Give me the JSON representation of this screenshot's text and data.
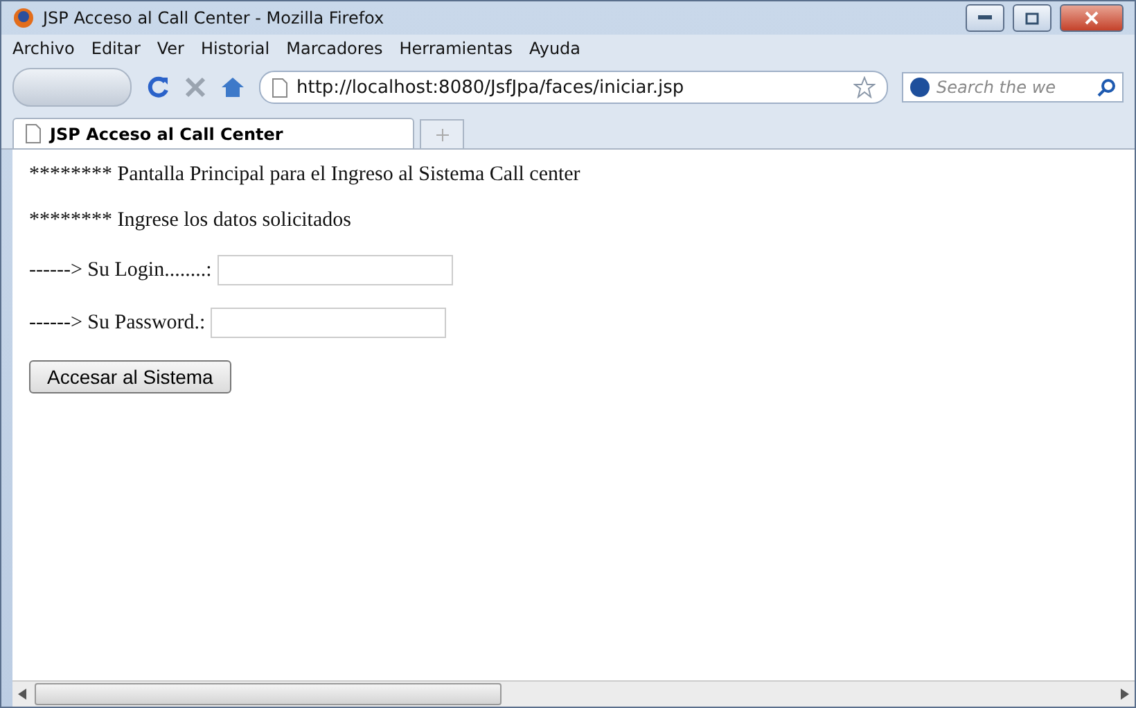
{
  "window": {
    "title": "JSP Acceso al Call Center - Mozilla Firefox"
  },
  "menu": [
    "Archivo",
    "Editar",
    "Ver",
    "Historial",
    "Marcadores",
    "Herramientas",
    "Ayuda"
  ],
  "address": {
    "value": "http://localhost:8080/JsfJpa/faces/iniciar.jsp"
  },
  "search": {
    "placeholder": "Search the we"
  },
  "tabs": [
    {
      "label": "JSP Acceso al Call Center",
      "selected": true
    }
  ],
  "page": {
    "lines": [
      "******** Pantalla Principal para el Ingreso al Sistema Call center",
      "******** Ingrese los datos solicitados"
    ],
    "fields": [
      {
        "label": "------> Su Login........:"
      },
      {
        "label": "------> Su Password.:"
      }
    ],
    "button": "Accesar al Sistema"
  }
}
